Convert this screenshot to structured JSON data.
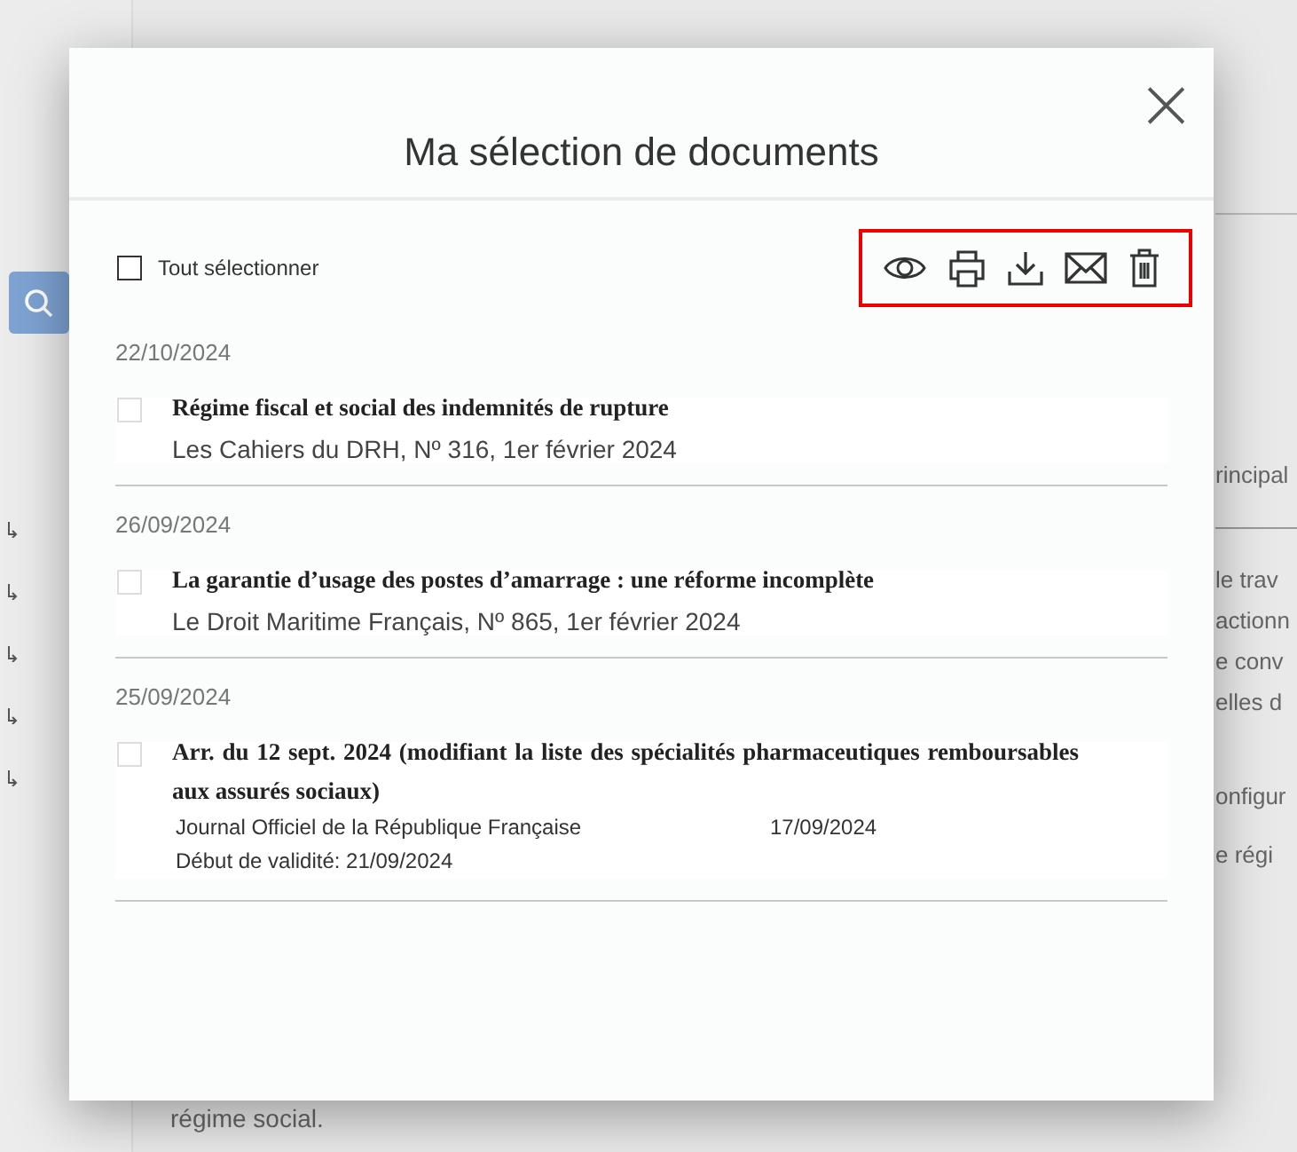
{
  "background": {
    "right_texts": [
      "rincipal",
      "le trav",
      "actionn",
      "e conv",
      "elles d",
      "onfigur",
      "e régi"
    ],
    "bottom_text": "régime social."
  },
  "dialog": {
    "title": "Ma sélection de documents",
    "close": "×",
    "select_all": {
      "label": "Tout sélectionner",
      "checked": false
    },
    "documents": [
      {
        "kind": "article",
        "date": "22/10/2024",
        "checked": false,
        "title": "Régime fiscal et social des indemnités de rupture",
        "source": "Les Cahiers du DRH, Nº 316, 1er février 2024"
      },
      {
        "kind": "article",
        "date": "26/09/2024",
        "checked": false,
        "title": "La garantie d’usage des postes d’amarrage : une réforme incomplète",
        "source": "Le Droit Maritime Français, Nº 865, 1er février 2024"
      },
      {
        "kind": "official",
        "date": "25/09/2024",
        "checked": false,
        "title": "Arr. du 12 sept. 2024 (modifiant la liste des spécialités pharmaceutiques remboursables aux assurés sociaux)",
        "source": "Journal Officiel de la République Française",
        "published": "17/09/2024",
        "validity": "Début de validité: 21/09/2024"
      }
    ]
  }
}
